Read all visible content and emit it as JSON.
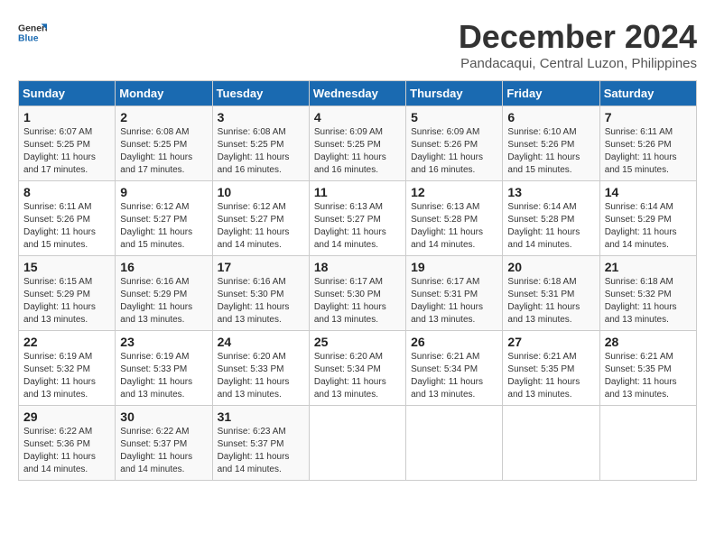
{
  "logo": {
    "line1": "General",
    "line2": "Blue"
  },
  "title": "December 2024",
  "subtitle": "Pandacaqui, Central Luzon, Philippines",
  "days_header": [
    "Sunday",
    "Monday",
    "Tuesday",
    "Wednesday",
    "Thursday",
    "Friday",
    "Saturday"
  ],
  "weeks": [
    [
      {
        "day": "1",
        "info": "Sunrise: 6:07 AM\nSunset: 5:25 PM\nDaylight: 11 hours and 17 minutes."
      },
      {
        "day": "2",
        "info": "Sunrise: 6:08 AM\nSunset: 5:25 PM\nDaylight: 11 hours and 17 minutes."
      },
      {
        "day": "3",
        "info": "Sunrise: 6:08 AM\nSunset: 5:25 PM\nDaylight: 11 hours and 16 minutes."
      },
      {
        "day": "4",
        "info": "Sunrise: 6:09 AM\nSunset: 5:25 PM\nDaylight: 11 hours and 16 minutes."
      },
      {
        "day": "5",
        "info": "Sunrise: 6:09 AM\nSunset: 5:26 PM\nDaylight: 11 hours and 16 minutes."
      },
      {
        "day": "6",
        "info": "Sunrise: 6:10 AM\nSunset: 5:26 PM\nDaylight: 11 hours and 15 minutes."
      },
      {
        "day": "7",
        "info": "Sunrise: 6:11 AM\nSunset: 5:26 PM\nDaylight: 11 hours and 15 minutes."
      }
    ],
    [
      {
        "day": "8",
        "info": "Sunrise: 6:11 AM\nSunset: 5:26 PM\nDaylight: 11 hours and 15 minutes."
      },
      {
        "day": "9",
        "info": "Sunrise: 6:12 AM\nSunset: 5:27 PM\nDaylight: 11 hours and 15 minutes."
      },
      {
        "day": "10",
        "info": "Sunrise: 6:12 AM\nSunset: 5:27 PM\nDaylight: 11 hours and 14 minutes."
      },
      {
        "day": "11",
        "info": "Sunrise: 6:13 AM\nSunset: 5:27 PM\nDaylight: 11 hours and 14 minutes."
      },
      {
        "day": "12",
        "info": "Sunrise: 6:13 AM\nSunset: 5:28 PM\nDaylight: 11 hours and 14 minutes."
      },
      {
        "day": "13",
        "info": "Sunrise: 6:14 AM\nSunset: 5:28 PM\nDaylight: 11 hours and 14 minutes."
      },
      {
        "day": "14",
        "info": "Sunrise: 6:14 AM\nSunset: 5:29 PM\nDaylight: 11 hours and 14 minutes."
      }
    ],
    [
      {
        "day": "15",
        "info": "Sunrise: 6:15 AM\nSunset: 5:29 PM\nDaylight: 11 hours and 13 minutes."
      },
      {
        "day": "16",
        "info": "Sunrise: 6:16 AM\nSunset: 5:29 PM\nDaylight: 11 hours and 13 minutes."
      },
      {
        "day": "17",
        "info": "Sunrise: 6:16 AM\nSunset: 5:30 PM\nDaylight: 11 hours and 13 minutes."
      },
      {
        "day": "18",
        "info": "Sunrise: 6:17 AM\nSunset: 5:30 PM\nDaylight: 11 hours and 13 minutes."
      },
      {
        "day": "19",
        "info": "Sunrise: 6:17 AM\nSunset: 5:31 PM\nDaylight: 11 hours and 13 minutes."
      },
      {
        "day": "20",
        "info": "Sunrise: 6:18 AM\nSunset: 5:31 PM\nDaylight: 11 hours and 13 minutes."
      },
      {
        "day": "21",
        "info": "Sunrise: 6:18 AM\nSunset: 5:32 PM\nDaylight: 11 hours and 13 minutes."
      }
    ],
    [
      {
        "day": "22",
        "info": "Sunrise: 6:19 AM\nSunset: 5:32 PM\nDaylight: 11 hours and 13 minutes."
      },
      {
        "day": "23",
        "info": "Sunrise: 6:19 AM\nSunset: 5:33 PM\nDaylight: 11 hours and 13 minutes."
      },
      {
        "day": "24",
        "info": "Sunrise: 6:20 AM\nSunset: 5:33 PM\nDaylight: 11 hours and 13 minutes."
      },
      {
        "day": "25",
        "info": "Sunrise: 6:20 AM\nSunset: 5:34 PM\nDaylight: 11 hours and 13 minutes."
      },
      {
        "day": "26",
        "info": "Sunrise: 6:21 AM\nSunset: 5:34 PM\nDaylight: 11 hours and 13 minutes."
      },
      {
        "day": "27",
        "info": "Sunrise: 6:21 AM\nSunset: 5:35 PM\nDaylight: 11 hours and 13 minutes."
      },
      {
        "day": "28",
        "info": "Sunrise: 6:21 AM\nSunset: 5:35 PM\nDaylight: 11 hours and 13 minutes."
      }
    ],
    [
      {
        "day": "29",
        "info": "Sunrise: 6:22 AM\nSunset: 5:36 PM\nDaylight: 11 hours and 14 minutes."
      },
      {
        "day": "30",
        "info": "Sunrise: 6:22 AM\nSunset: 5:37 PM\nDaylight: 11 hours and 14 minutes."
      },
      {
        "day": "31",
        "info": "Sunrise: 6:23 AM\nSunset: 5:37 PM\nDaylight: 11 hours and 14 minutes."
      },
      null,
      null,
      null,
      null
    ]
  ]
}
